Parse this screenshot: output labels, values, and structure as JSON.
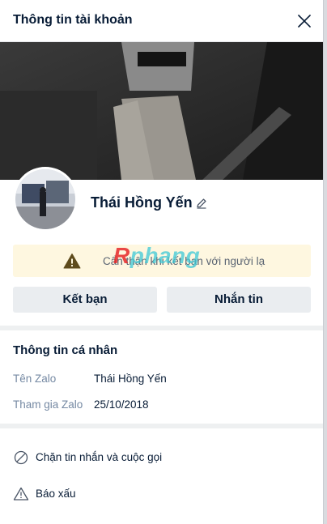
{
  "header": {
    "title": "Thông tin tài khoản"
  },
  "profile": {
    "name": "Thái Hồng Yến"
  },
  "warning": {
    "text": "Cẩn thận khi kết bạn với người lạ"
  },
  "watermark": {
    "first": "R",
    "rest": "phang"
  },
  "buttons": {
    "add_friend": "Kết bạn",
    "message": "Nhắn tin"
  },
  "personal_info": {
    "title": "Thông tin cá nhân",
    "rows": [
      {
        "label": "Tên Zalo",
        "value": "Thái Hồng Yến"
      },
      {
        "label": "Tham gia Zalo",
        "value": "25/10/2018"
      }
    ]
  },
  "actions": [
    {
      "label": "Chặn tin nhắn và cuộc gọi",
      "icon": "block-icon"
    },
    {
      "label": "Báo xấu",
      "icon": "warning-triangle-icon"
    }
  ],
  "colors": {
    "warning_bg": "#fef7e0",
    "warning_icon": "#5e4b1c",
    "button_bg": "#eaedf0",
    "label": "#7589a3",
    "text": "#081c36"
  }
}
